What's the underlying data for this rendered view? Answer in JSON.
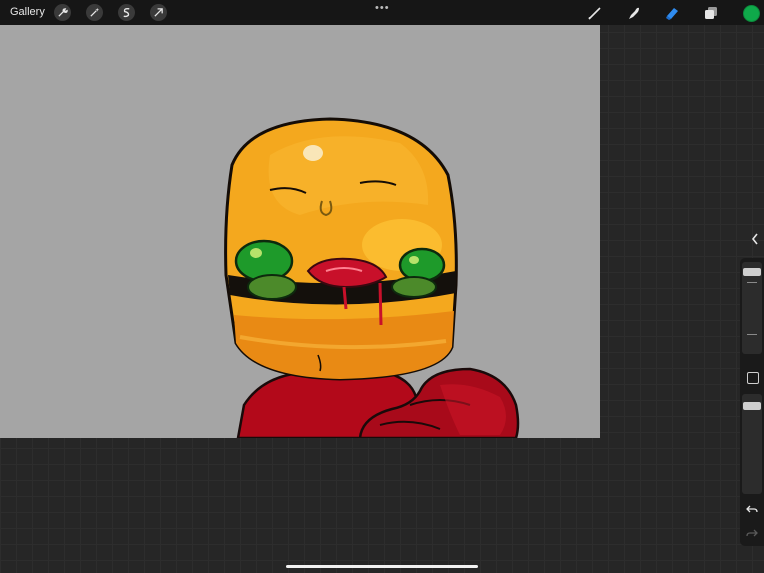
{
  "topbar": {
    "gallery_label": "Gallery",
    "left_tools": [
      "wrench-icon",
      "magic-wand-icon",
      "selection-s-icon",
      "transform-arrow-icon"
    ],
    "more_label": "•••",
    "right_tools": [
      "brush-icon",
      "smudge-icon",
      "eraser-icon",
      "layers-icon"
    ],
    "active_tool": "eraser-icon",
    "current_color": "#0fa94a"
  },
  "sidebar": {
    "brush_size_level": 0.95,
    "opacity_level": 0.95,
    "icons": [
      "collapse-chevron-icon",
      "modify-square-icon",
      "undo-icon",
      "redo-icon"
    ]
  }
}
